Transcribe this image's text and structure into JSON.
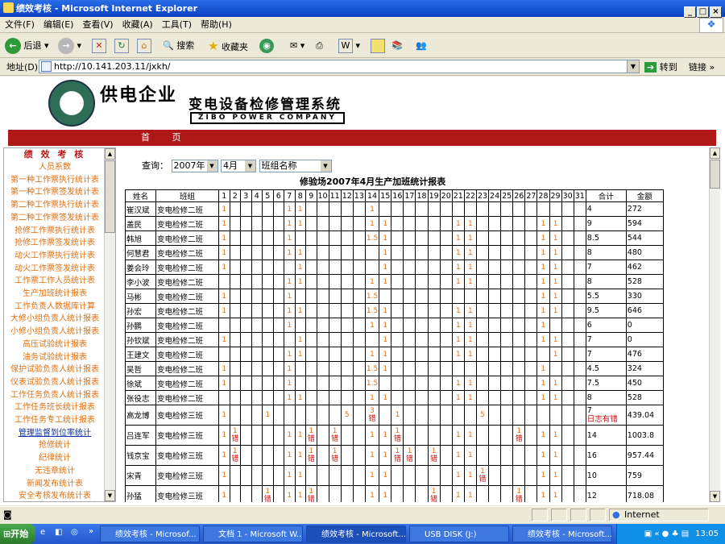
{
  "window": {
    "title": "绩效考核 - Microsoft Internet Explorer"
  },
  "menu": [
    "文件(F)",
    "编辑(E)",
    "查看(V)",
    "收藏(A)",
    "工具(T)",
    "帮助(H)"
  ],
  "toolbar": {
    "back": "后退",
    "search": "搜索",
    "favorites": "收藏夹"
  },
  "address": {
    "label": "地址(D)",
    "url": "http://10.141.203.11/jxkh/",
    "go": "转到",
    "links": "链接"
  },
  "banner": {
    "title1": "供电企业",
    "title2": "变电设备检修管理系统",
    "title3": "ZIBO POWER COMPANY"
  },
  "nav": {
    "home": "首 页"
  },
  "left": {
    "title": "绩 效 考 核",
    "items": [
      "人员系数",
      "第一种工作票执行统计表",
      "第一种工作票签发统计表",
      "第二种工作票执行统计表",
      "第二种工作票签发统计表",
      "抢修工作票执行统计表",
      "抢修工作票签发统计表",
      "动火工作票执行统计表",
      "动火工作票签发统计表",
      "工作票工作人员统计表",
      "生产加班统计报表",
      "工作负责人数据库计算",
      "大修小组负责人统计报表",
      "小修小组负责人统计报表",
      "高压试验统计报表",
      "油务试验统计报表",
      "保护试验负责人统计报表",
      "仪表试验负责人统计报表",
      "工作任务负责人统计报表",
      "工作任务班长统计报表",
      "工作任务专工统计报表",
      "管理监督到位率统计",
      "抢修统计",
      "纪律统计",
      "无违章统计",
      "新闻发布统计表",
      "安全考核发布统计表"
    ]
  },
  "query": {
    "label": "查询：",
    "year": "2007年",
    "month": "4月",
    "team": "班组名称"
  },
  "report": {
    "title": "修验场2007年4月生产加班统计报表",
    "headers": {
      "name": "姓名",
      "team": "班组",
      "total": "合计",
      "amount": "金额"
    },
    "days": [
      "1",
      "2",
      "3",
      "4",
      "5",
      "6",
      "7",
      "8",
      "9",
      "10",
      "11",
      "12",
      "13",
      "14",
      "15",
      "16",
      "17",
      "18",
      "19",
      "20",
      "21",
      "22",
      "23",
      "24",
      "25",
      "26",
      "27",
      "28",
      "29",
      "30",
      "31"
    ],
    "rows": [
      {
        "name": "崔汉斌",
        "team": "变电检修二班",
        "cells": {
          "1": "1",
          "7": "1",
          "8": "1",
          "14": "1"
        },
        "total": "4",
        "amount": "272"
      },
      {
        "name": "盖民",
        "team": "变电检修二班",
        "cells": {
          "1": "1",
          "7": "1",
          "8": "1",
          "14": "1",
          "15": "1",
          "21": "1",
          "22": "1",
          "28": "1",
          "29": "1"
        },
        "total": "9",
        "amount": "594"
      },
      {
        "name": "韩旭",
        "team": "变电检修二班",
        "cells": {
          "1": "1",
          "7": "1",
          "14": "1.5",
          "15": "1",
          "21": "1",
          "22": "1",
          "28": "1",
          "29": "1"
        },
        "total": "8.5",
        "amount": "544"
      },
      {
        "name": "何慧君",
        "team": "变电检修二班",
        "cells": {
          "1": "1",
          "7": "1",
          "8": "1",
          "15": "1",
          "21": "1",
          "22": "1",
          "28": "1",
          "29": "1"
        },
        "total": "8",
        "amount": "480"
      },
      {
        "name": "姜会玲",
        "team": "变电检修二班",
        "cells": {
          "1": "1",
          "8": "1",
          "15": "1",
          "21": "1",
          "22": "1",
          "28": "1",
          "29": "1"
        },
        "total": "7",
        "amount": "462"
      },
      {
        "name": "李小波",
        "team": "变电检修二班",
        "cells": {
          "7": "1",
          "8": "1",
          "14": "1",
          "15": "1",
          "21": "1",
          "22": "1",
          "28": "1",
          "29": "1"
        },
        "total": "8",
        "amount": "528"
      },
      {
        "name": "马彬",
        "team": "变电检修二班",
        "cells": {
          "1": "1",
          "7": "1",
          "14": "1.5",
          "28": "1",
          "29": "1"
        },
        "total": "5.5",
        "amount": "330"
      },
      {
        "name": "孙宏",
        "team": "变电检修二班",
        "cells": {
          "1": "1",
          "7": "1",
          "8": "1",
          "14": "1.5",
          "15": "1",
          "21": "1",
          "22": "1",
          "28": "1",
          "29": "1"
        },
        "total": "9.5",
        "amount": "646"
      },
      {
        "name": "孙鹏",
        "team": "变电检修二班",
        "cells": {
          "7": "1",
          "14": "1",
          "15": "1",
          "21": "1",
          "22": "1",
          "28": "1"
        },
        "total": "6",
        "amount": "0"
      },
      {
        "name": "孙钦斌",
        "team": "变电检修二班",
        "cells": {
          "1": "1",
          "8": "1",
          "15": "1",
          "21": "1",
          "22": "1",
          "28": "1",
          "29": "1"
        },
        "total": "7",
        "amount": "0"
      },
      {
        "name": "王建文",
        "team": "变电检修二班",
        "cells": {
          "7": "1",
          "8": "1",
          "14": "1",
          "15": "1",
          "21": "1",
          "22": "1",
          "29": "1"
        },
        "total": "7",
        "amount": "476"
      },
      {
        "name": "吴哲",
        "team": "变电检修二班",
        "cells": {
          "1": "1",
          "7": "1",
          "14": "1.5",
          "15": "1",
          "28": "1"
        },
        "total": "4.5",
        "amount": "324"
      },
      {
        "name": "徐斌",
        "team": "变电检修二班",
        "cells": {
          "1": "1",
          "7": "1",
          "14": "1.5",
          "21": "1",
          "22": "1",
          "28": "1",
          "29": "1"
        },
        "total": "7.5",
        "amount": "450"
      },
      {
        "name": "张役志",
        "team": "变电检修二班",
        "cells": {
          "7": "1",
          "8": "1",
          "14": "1",
          "15": "1",
          "21": "1",
          "22": "1",
          "28": "1",
          "29": "1"
        },
        "total": "8",
        "amount": "528"
      },
      {
        "name": "高龙博",
        "team": "变电检修三班",
        "cells": {
          "1": "1",
          "5": "1",
          "12": "5",
          "14": "3|错",
          "16": "1",
          "23": "5"
        },
        "total": "7",
        "totalErr": "日志有错",
        "amount": "439.04"
      },
      {
        "name": "吕连军",
        "team": "变电检修三班",
        "cells": {
          "1": "1",
          "2": "1|错",
          "7": "1",
          "8": "1",
          "9": "1|错",
          "11": "1|错",
          "14": "1",
          "15": "1",
          "16": "1|错",
          "21": "1",
          "22": "1",
          "26": "1|错",
          "28": "1",
          "29": "1"
        },
        "total": "14",
        "amount": "1003.8"
      },
      {
        "name": "钱京宝",
        "team": "变电检修三班",
        "cells": {
          "1": "1",
          "2": "1|错",
          "7": "1",
          "8": "1",
          "9": "1|错",
          "11": "1|错",
          "14": "1",
          "15": "1",
          "16": "1|错",
          "17": "1|错",
          "19": "1|错",
          "21": "1",
          "22": "1",
          "28": "1",
          "29": "1"
        },
        "total": "16",
        "amount": "957.44"
      },
      {
        "name": "宋青",
        "team": "变电检修三班",
        "cells": {
          "1": "1",
          "7": "1",
          "8": "1",
          "14": "1",
          "15": "1",
          "21": "1",
          "22": "1",
          "23": "1|错",
          "28": "1",
          "29": "1"
        },
        "total": "10",
        "amount": "759"
      },
      {
        "name": "孙猛",
        "team": "变电检修三班",
        "cells": {
          "1": "1",
          "5": "1|错",
          "7": "1",
          "8": "1",
          "9": "1|错",
          "14": "1",
          "15": "1",
          "19": "1|错",
          "21": "1",
          "22": "1",
          "26": "1|错",
          "28": "1",
          "29": "1"
        },
        "total": "12",
        "amount": "718.08"
      }
    ]
  },
  "status": {
    "zone": "Internet"
  },
  "taskbar": {
    "start": "开始",
    "buttons": [
      "绩效考核 - Microsof...",
      "文档 1 - Microsoft W...",
      "绩效考核 - Microsoft...",
      "USB DISK (J:)",
      "绩效考核 - Microsoft..."
    ],
    "clock": "13:05"
  }
}
